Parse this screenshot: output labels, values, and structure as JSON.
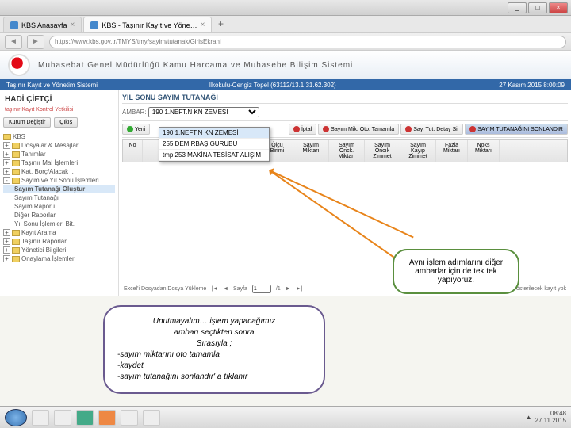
{
  "window": {
    "min": "_",
    "max": "□",
    "close": "×"
  },
  "tabs": {
    "t1": "KBS Anasayfa",
    "t2": "KBS - Taşınır Kayıt ve Yöne…",
    "plus": "+"
  },
  "url": "https://www.kbs.gov.tr/TMYS/tmy/sayim/tutanak/GirisEkrani",
  "header": "Muhasebat Genel Müdürlüğü Kamu Harcama ve Muhasebe Bilişim Sistemi",
  "sub": {
    "l": "Taşınır Kayıt ve Yönetim Sistemi",
    "m": "İlkokulu-Cengiz Topel (63112/13.1.31.62.302)",
    "r": "27 Kasım 2015 8:00:09"
  },
  "side": {
    "user": "HADİ ÇİFTÇİ",
    "info": "taşınır Kayıt Kontrol Yetkilisi",
    "b1": "Kurum Değiştir",
    "b2": "Çıkış",
    "nodes": [
      "KBS",
      "Dosyalar & Mesajlar",
      "Tanımlar",
      "Taşınır Mal İşlemleri",
      "Kat. Borç/Alacak İ.",
      "Sayım ve Yıl Sonu İşlemleri",
      "Sayım Tutanağı Oluştur",
      "Sayım Tutanağı",
      "Sayım Raporu",
      "Diğer Raporlar",
      "Yıl Sonu İşlemleri Bit.",
      "Kayıt Arama",
      "Taşınır Raporlar",
      "Yönetici Bilgileri",
      "Onaylama İşlemleri"
    ]
  },
  "main": {
    "title": "YIL SONU SAYIM TUTANAĞI",
    "ambarLabel": "AMBAR:",
    "ambarSel": "190 1.NEFT.N KN ZEMESİ",
    "dd": [
      "190 1.NEFT.N KN ZEMESİ",
      "255 DEMİRBAŞ GURUBU",
      "tmp 253 MAKİNA TESİSAT ALIŞIM"
    ],
    "tb": {
      "yeni": "Yeni",
      "iptal": "İptal",
      "smo": "Sayım Mik. Oto. Tamamla",
      "stb": "Say. Tut. Detay Sil",
      "sts": "SAYIM TUTANAĞINI SONLANDIR"
    },
    "cols": {
      "no": "No",
      "urun": "Ürün",
      "olcu": "Ölçü Birimi",
      "sm": "Sayım Miktarı",
      "som": "Sayım Önck. Miktarı",
      "sof": "Sayım Oncık Zimmet",
      "sk": "Sayım Kayıp Zimmet",
      "fm": "Fazla Miktarı",
      "nm": "Noks Miktarı"
    },
    "pager": {
      "upload": "Excel'i Dosyadan Dosya Yükleme",
      "sayfa": "Sayfa",
      "of": "/1",
      "no": "Gösterilecek kayıt yok"
    }
  },
  "call1": "Aynı işlem adımlarını diğer ambarlar için de tek tek yapıyoruz.",
  "call2": {
    "l1": "Unutmayalım… işlem yapacağımız",
    "l2": "ambarı seçtikten sonra",
    "l3": "Sırasıyla ;",
    "l4": "-sayım miktarını oto tamamla",
    "l5": "-kaydet",
    "l6": "-sayım tutanağını sonlandır' a tıklanır"
  },
  "clock": {
    "t": "08:48",
    "d": "27.11.2015"
  }
}
